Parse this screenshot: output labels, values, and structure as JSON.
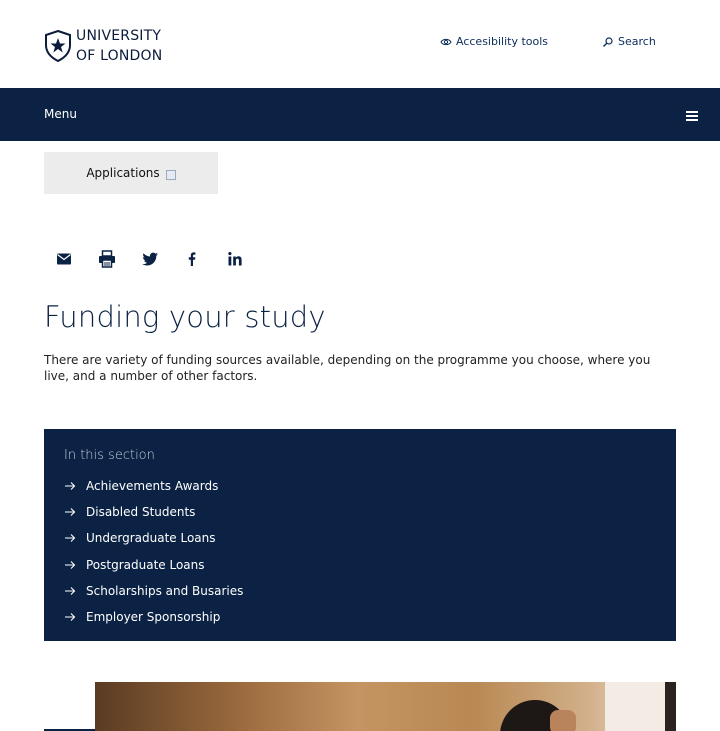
{
  "header": {
    "logo_line1": "UNIVERSITY",
    "logo_line2": "OF LONDON",
    "accessibility_label": "Accesibility tools",
    "search_label": "Search"
  },
  "menubar": {
    "menu_label": "Menu"
  },
  "applications_button": {
    "label": "Applications"
  },
  "share": {
    "icons": [
      "email-icon",
      "print-icon",
      "twitter-icon",
      "facebook-icon",
      "linkedin-icon"
    ]
  },
  "main": {
    "title": "Funding your study",
    "intro": "There are variety of funding sources available, depending on the programme you choose, where you live, and a number of other factors."
  },
  "in_this_section": {
    "title": "In this section",
    "links": [
      "Achievements Awards",
      "Disabled Students",
      "Undergraduate Loans",
      "Postgraduate Loans",
      "Scholarships and Busaries",
      "Employer Sponsorship"
    ]
  },
  "colors": {
    "navy": "#0b2244",
    "button_grey": "#ececec"
  }
}
